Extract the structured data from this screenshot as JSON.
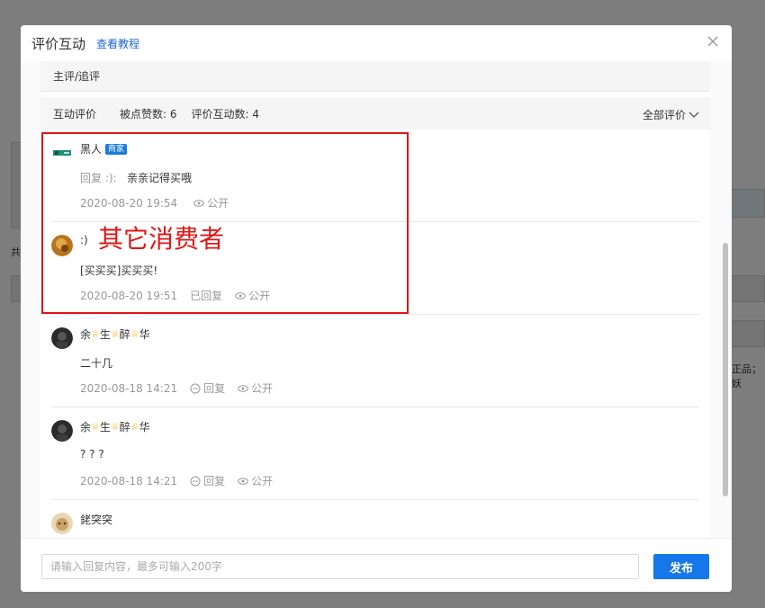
{
  "background": {
    "left_fragment": "共",
    "right_fragment": "正品；妖"
  },
  "modal": {
    "title": "评价互动",
    "tutorial_link": "查看教程",
    "section_main": "主评/追评",
    "interaction": {
      "label": "互动评价",
      "likes": "被点赞数: 6",
      "count": "评价互动数: 4",
      "filter": "全部评价"
    },
    "items": [
      {
        "user": "黑人",
        "badge": "商家",
        "reply_label": "回复 :):",
        "text": "亲亲记得买哦",
        "time": "2020-08-20 19:54",
        "status": "",
        "visibility": "公开"
      },
      {
        "user": ":)",
        "text": "[买买买]买买买!",
        "time": "2020-08-20 19:51",
        "status": "已回复",
        "visibility": "公开"
      },
      {
        "user_parts": [
          "余",
          "生",
          "醉",
          "华"
        ],
        "text": "二十几",
        "time": "2020-08-18 14:21",
        "reply": "回复",
        "visibility": "公开"
      },
      {
        "user_parts": [
          "余",
          "生",
          "醉",
          "华"
        ],
        "text": "? ? ?",
        "time": "2020-08-18 14:21",
        "reply": "回复",
        "visibility": "公开"
      },
      {
        "user": "銠突突"
      }
    ],
    "annotation": "其它消费者",
    "input_placeholder": "请输入回复内容，最多可输入200字",
    "publish": "发布"
  },
  "colors": {
    "accent": "#1677e8",
    "link": "#1a66d6",
    "highlight": "#e01616",
    "crown": "#f2c04a"
  },
  "icons": [
    "close-icon",
    "chevron-down-icon",
    "eye-icon",
    "comment-icon",
    "crown-icon"
  ]
}
